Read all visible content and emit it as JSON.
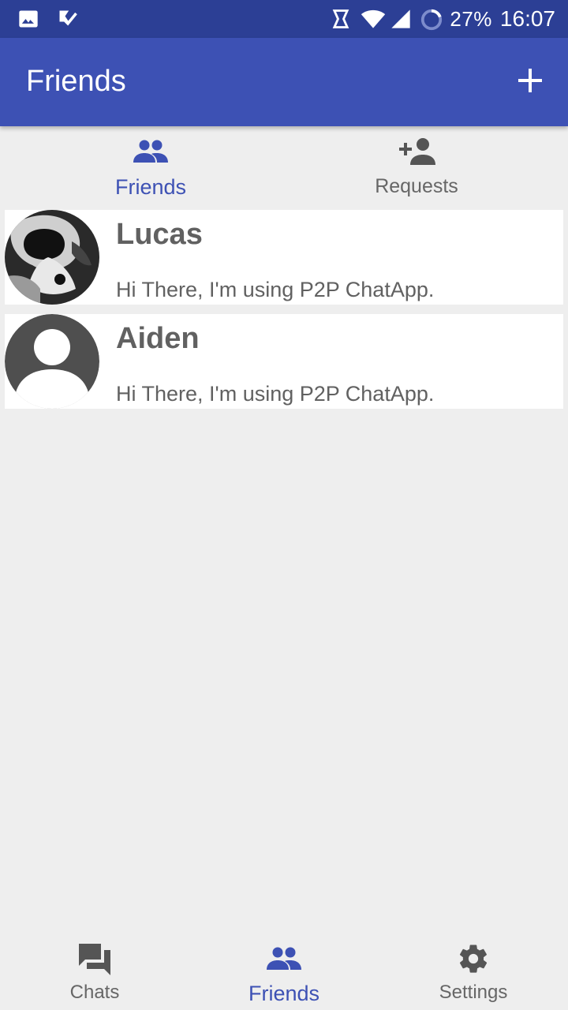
{
  "status_bar": {
    "battery": "27%",
    "time": "16:07",
    "icons": [
      "image-icon",
      "check-notification-icon",
      "vibrate-icon",
      "wifi-icon",
      "signal-icon",
      "battery-ring-icon"
    ]
  },
  "app_bar": {
    "title": "Friends",
    "add_icon": "plus-icon"
  },
  "top_tabs": [
    {
      "label": "Friends",
      "icon": "people-icon",
      "active": true
    },
    {
      "label": "Requests",
      "icon": "person-add-icon",
      "active": false
    }
  ],
  "friends": [
    {
      "name": "Lucas",
      "status": "Hi There, I'm using P2P ChatApp.",
      "avatar": "photo"
    },
    {
      "name": "Aiden",
      "status": "Hi There, I'm using P2P ChatApp.",
      "avatar": "default"
    }
  ],
  "bottom_nav": [
    {
      "label": "Chats",
      "icon": "chat-icon",
      "active": false
    },
    {
      "label": "Friends",
      "icon": "people-icon",
      "active": true
    },
    {
      "label": "Settings",
      "icon": "gear-icon",
      "active": false
    }
  ],
  "colors": {
    "status_bar": "#2c3f95",
    "primary": "#3d51b4",
    "background": "#eeeeee",
    "text_gray": "#616161"
  }
}
